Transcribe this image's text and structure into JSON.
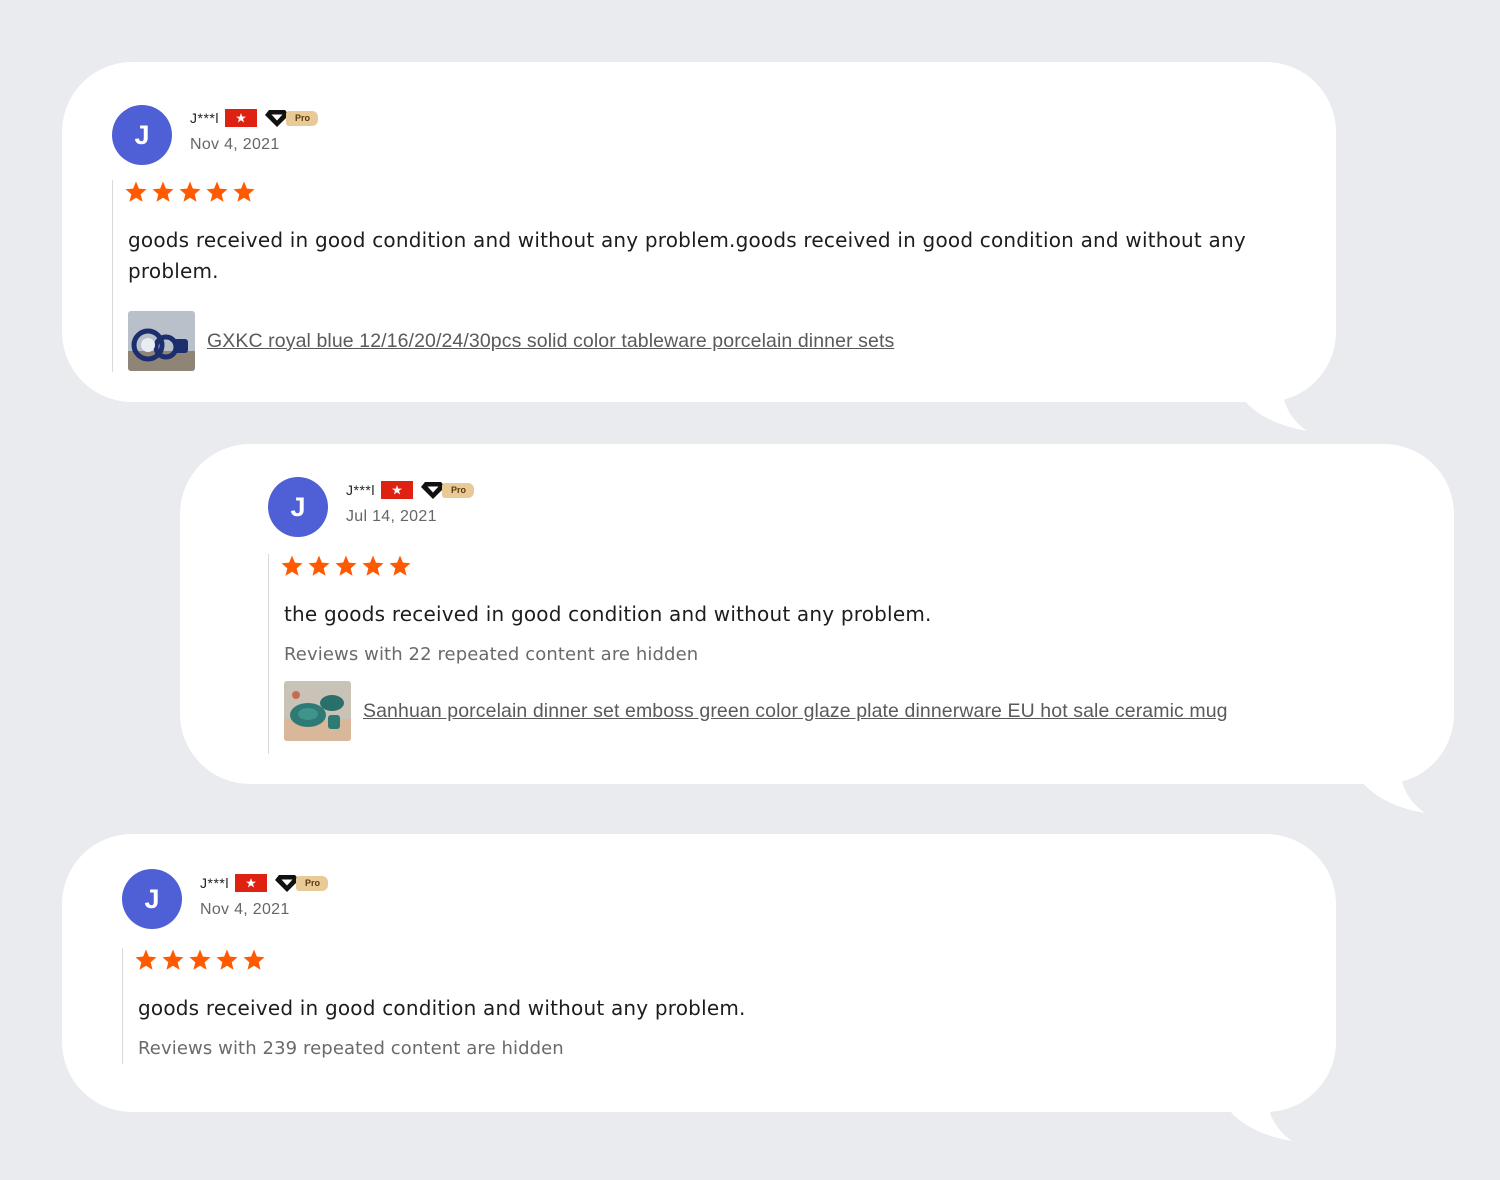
{
  "reviews": [
    {
      "avatar_letter": "J",
      "name": "J***l",
      "pro_label": "Pro",
      "date": "Nov 4, 2021",
      "rating": 5,
      "text": "goods received in good condition and without any problem.goods received in good condition and without any problem.",
      "hidden_note": "",
      "product_title": "GXKC royal blue 12/16/20/24/30pcs solid color tableware porcelain dinner sets"
    },
    {
      "avatar_letter": "J",
      "name": "J***l",
      "pro_label": "Pro",
      "date": "Jul 14, 2021",
      "rating": 5,
      "text": "the goods received in good condition and without any problem.",
      "hidden_note": "Reviews with 22 repeated content are hidden",
      "product_title": "Sanhuan porcelain dinner set emboss green color glaze plate dinnerware EU hot sale ceramic mug"
    },
    {
      "avatar_letter": "J",
      "name": "J***l",
      "pro_label": "Pro",
      "date": "Nov 4, 2021",
      "rating": 5,
      "text": "goods received in good condition and without any problem.",
      "hidden_note": "Reviews with 239 repeated content are hidden",
      "product_title": ""
    }
  ],
  "colors": {
    "page_bg": "#e9ebef",
    "bubble_bg": "#ffffff",
    "avatar_bg": "#4f5fd6",
    "star": "#ff5a00",
    "flag": "#de2110",
    "pro_badge": "#e9c995"
  },
  "icons": [
    "flag-icon",
    "diamond-badge-icon",
    "star-icon"
  ]
}
